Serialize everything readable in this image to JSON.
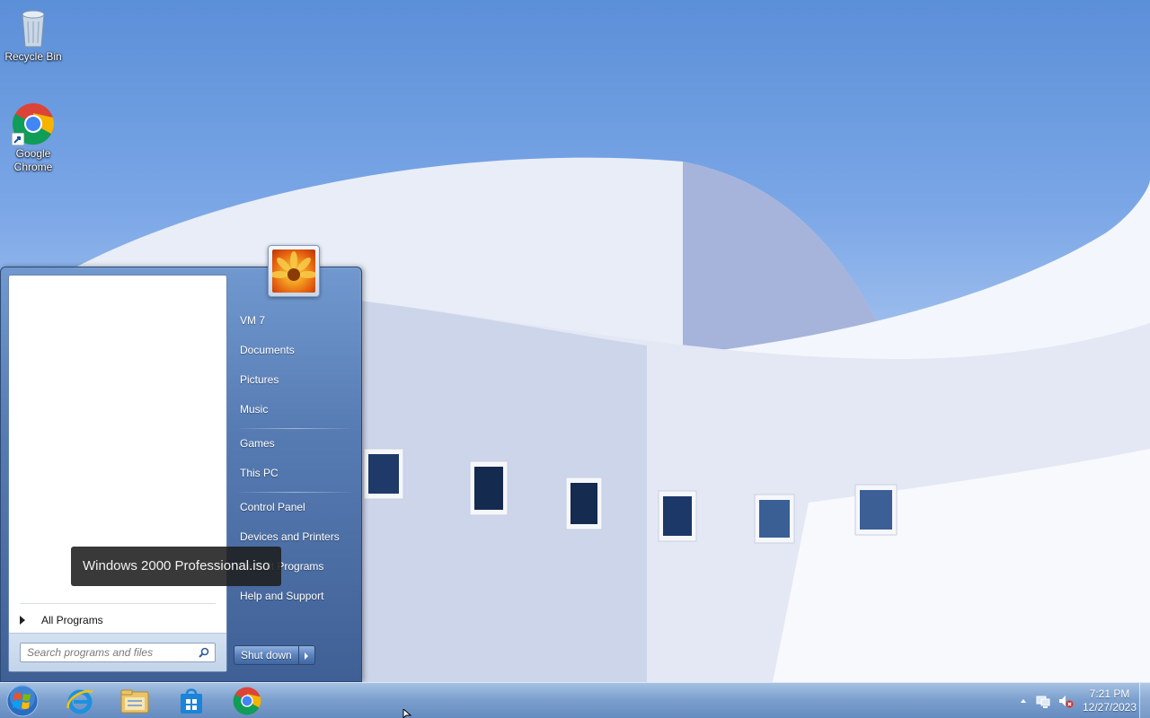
{
  "desktop": {
    "icons": [
      {
        "label": "Recycle Bin",
        "icon": "recycle-bin-icon"
      },
      {
        "label": "Google Chrome",
        "icon": "chrome-icon"
      }
    ]
  },
  "start_menu": {
    "user_picture": "flower-user-picture",
    "right_items": [
      "VM 7",
      "Documents",
      "Pictures",
      "Music",
      "Games",
      "This PC",
      "Control Panel",
      "Devices and Printers",
      "Default Programs",
      "Help and Support"
    ],
    "all_programs_label": "All Programs",
    "search_placeholder": "Search programs and files",
    "shutdown_label": "Shut down"
  },
  "tooltip": {
    "text": "Windows 2000 Professional.iso"
  },
  "taskbar": {
    "pinned": [
      "internet-explorer-icon",
      "file-explorer-icon",
      "store-icon",
      "chrome-icon"
    ],
    "tray": [
      "show-hidden-icons",
      "network-icon",
      "volume-muted-icon"
    ],
    "clock": {
      "time": "7:21 PM",
      "date": "12/27/2023"
    }
  },
  "colors": {
    "taskbar": "#769ccc",
    "start_menu": "#5076af",
    "tooltip_bg": "#1e1e1e"
  }
}
